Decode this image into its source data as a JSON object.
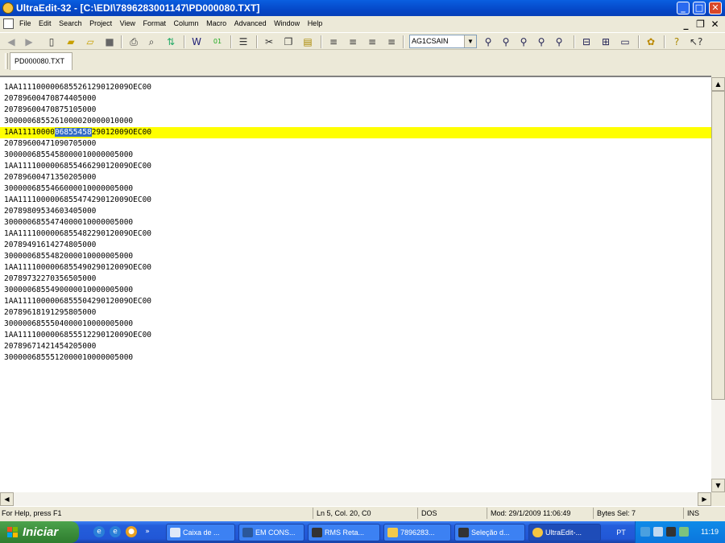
{
  "window": {
    "title": "UltraEdit-32 - [C:\\EDI\\7896283001147\\PD000080.TXT]",
    "controls": {
      "minimize": "_",
      "maximize": "□",
      "close": "✕"
    }
  },
  "menu": {
    "items": [
      "File",
      "Edit",
      "Search",
      "Project",
      "View",
      "Format",
      "Column",
      "Macro",
      "Advanced",
      "Window",
      "Help"
    ],
    "mdi_minimize": "_",
    "mdi_restore": "❐",
    "mdi_close": "✕"
  },
  "toolbar": {
    "font_combo_value": "AG1CSAIN",
    "icons": [
      "back-icon",
      "forward-icon",
      "new-file-icon",
      "open-folder-icon",
      "open-file-icon",
      "save-icon",
      "print-icon",
      "print-preview-icon",
      "ftp-icon",
      "word-wrap-icon",
      "hex-icon",
      "column-mode-icon",
      "cut-icon",
      "copy-icon",
      "paste-icon",
      "align-left-icon",
      "align-center-icon",
      "align-right-icon",
      "justify-icon",
      "find-icon",
      "find-next-icon",
      "find-prev-icon",
      "replace-icon",
      "find-in-files-icon",
      "split-horizontal-icon",
      "split-grid-icon",
      "window-icon",
      "settings-icon",
      "help-icon",
      "context-help-icon"
    ]
  },
  "tabs": [
    {
      "label": "PD000080.TXT",
      "active": true
    }
  ],
  "editor": {
    "lines": [
      "1AA111100000685526129012009OEC00",
      "20789600470874405000",
      "20789600470875105000",
      "3000006855261000020000010000",
      "1AA111100000685545829012009OEC00",
      "20789600471090705000",
      "3000006855458000010000005000",
      "1AA111100000685546629012009OEC00",
      "20789600471350205000",
      "3000006855466000010000005000",
      "1AA111100000685547429012009OEC00",
      "20789809534603405000",
      "3000006855474000010000005000",
      "1AA111100000685548229012009OEC00",
      "20789491614274805000",
      "3000006855482000010000005000",
      "1AA111100000685549029012009OEC00",
      "20789732270356505000",
      "3000006855490000010000005000",
      "1AA111100000685550429012009OEC00",
      "20789618191295805000",
      "3000006855504000010000005000",
      "1AA111100000685551229012009OEC00",
      "20789671421454205000",
      "3000006855512000010000005000"
    ],
    "highlight_line_index": 4,
    "highlight_parts": {
      "before": "1AA11110000",
      "selected": "06855458",
      "after": "29012009OEC00"
    },
    "highlight_color": "#ffff00",
    "selection_color": "#316ac5"
  },
  "statusbar": {
    "help": "For Help, press F1",
    "position": "Ln 5, Col. 20, C0",
    "format": "DOS",
    "modified": "Mod: 29/1/2009 11:06:49",
    "bytes_sel": "Bytes Sel: 7",
    "ins": "INS"
  },
  "taskbar": {
    "start_label": "Iniciar",
    "tasks": [
      {
        "label": "Caixa de ...",
        "icon": "mail-icon",
        "active": false
      },
      {
        "label": "EM CONS...",
        "icon": "word-icon",
        "active": false
      },
      {
        "label": "RMS Reta...",
        "icon": "rms-icon",
        "active": false
      },
      {
        "label": "7896283...",
        "icon": "folder-icon",
        "active": false
      },
      {
        "label": "Seleção d...",
        "icon": "rms-icon",
        "active": false
      },
      {
        "label": "UltraEdit-...",
        "icon": "ultraedit-icon",
        "active": true
      }
    ],
    "language": "PT",
    "clock": "11:19"
  }
}
